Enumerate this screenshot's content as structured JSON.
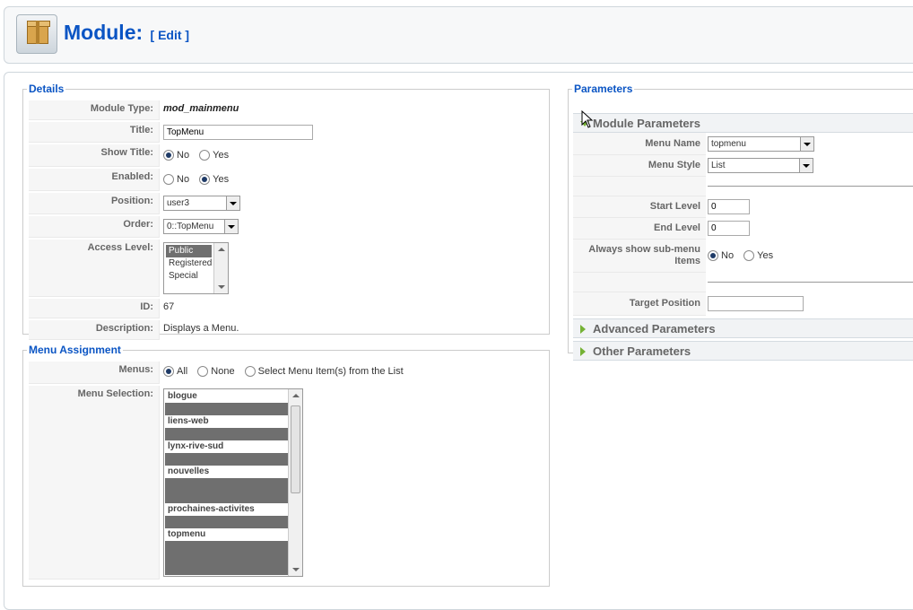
{
  "header": {
    "title": "Module:",
    "subtitle": "[ Edit ]"
  },
  "details": {
    "legend": "Details",
    "module_type_label": "Module Type:",
    "module_type_value": "mod_mainmenu",
    "title_label": "Title:",
    "title_value": "TopMenu",
    "show_title_label": "Show Title:",
    "show_title_no": "No",
    "show_title_yes": "Yes",
    "enabled_label": "Enabled:",
    "enabled_no": "No",
    "enabled_yes": "Yes",
    "position_label": "Position:",
    "position_value": "user3",
    "order_label": "Order:",
    "order_value": "0::TopMenu",
    "access_label": "Access Level:",
    "access_options": [
      "Public",
      "Registered",
      "Special"
    ],
    "id_label": "ID:",
    "id_value": "67",
    "description_label": "Description:",
    "description_value": "Displays a Menu."
  },
  "menu_assignment": {
    "legend": "Menu Assignment",
    "menus_label": "Menus:",
    "opt_all": "All",
    "opt_none": "None",
    "opt_select": "Select Menu Item(s) from the List",
    "selection_label": "Menu Selection:",
    "items": [
      "blogue",
      "liens-web",
      "lynx-rive-sud",
      "nouvelles",
      "prochaines-activites",
      "topmenu"
    ]
  },
  "parameters": {
    "legend": "Parameters",
    "module_params_title": "Module Parameters",
    "menu_name_label": "Menu Name",
    "menu_name_value": "topmenu",
    "menu_style_label": "Menu Style",
    "menu_style_value": "List",
    "start_level_label": "Start Level",
    "start_level_value": "0",
    "end_level_label": "End Level",
    "end_level_value": "0",
    "always_show_label": "Always show sub-menu Items",
    "always_show_no": "No",
    "always_show_yes": "Yes",
    "target_position_label": "Target Position",
    "target_position_value": "",
    "advanced_title": "Advanced Parameters",
    "other_title": "Other Parameters"
  },
  "colors": {
    "link_blue": "#0b55c4",
    "toggle_green": "#75b235",
    "selected_gray": "#6f6f6f"
  }
}
